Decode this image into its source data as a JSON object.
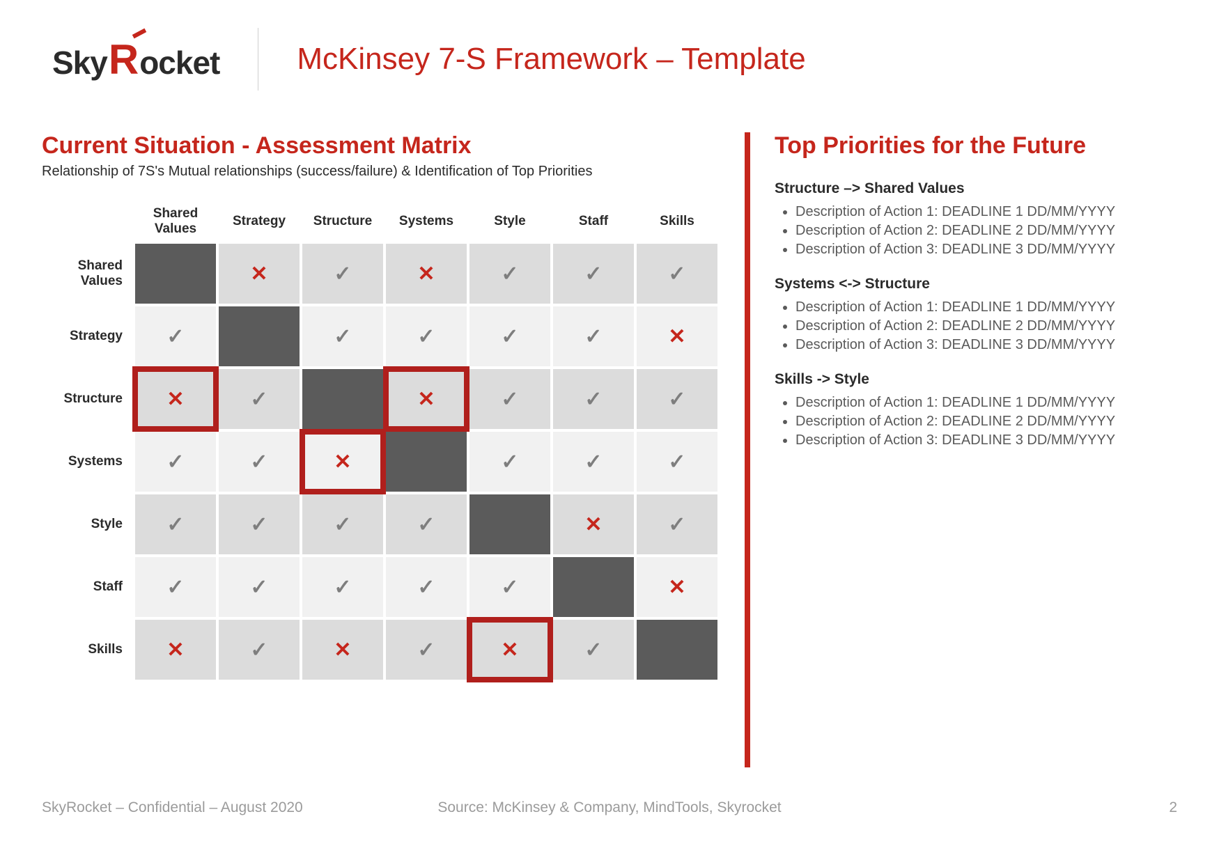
{
  "brand": {
    "part1": "Sky",
    "part2": "R",
    "part3": "ocket"
  },
  "header": {
    "title": "McKinsey 7-S Framework – Template"
  },
  "left_panel": {
    "title": "Current Situation - Assessment Matrix",
    "subtitle": "Relationship of 7S's Mutual relationships (success/failure) & Identification of Top Priorities"
  },
  "matrix": {
    "cols": [
      "Shared Values",
      "Strategy",
      "Structure",
      "Systems",
      "Style",
      "Staff",
      "Skills"
    ],
    "rows": [
      "Shared Values",
      "Strategy",
      "Structure",
      "Systems",
      "Style",
      "Staff",
      "Skills"
    ],
    "cells": [
      [
        "diag",
        "x",
        "v",
        "x",
        "v",
        "v",
        "v"
      ],
      [
        "v",
        "diag",
        "v",
        "v",
        "v",
        "v",
        "x"
      ],
      [
        "x",
        "v",
        "diag",
        "x",
        "v",
        "v",
        "v"
      ],
      [
        "v",
        "v",
        "x",
        "diag",
        "v",
        "v",
        "v"
      ],
      [
        "v",
        "v",
        "v",
        "v",
        "diag",
        "x",
        "v"
      ],
      [
        "v",
        "v",
        "v",
        "v",
        "v",
        "diag",
        "x"
      ],
      [
        "x",
        "v",
        "x",
        "v",
        "x",
        "v",
        "diag"
      ]
    ],
    "highlight": [
      [
        2,
        0
      ],
      [
        2,
        3
      ],
      [
        3,
        2
      ],
      [
        6,
        4
      ]
    ]
  },
  "right_panel": {
    "title": "Top Priorities for the Future",
    "groups": [
      {
        "heading": "Structure –> Shared Values",
        "items": [
          "Description of Action 1: DEADLINE 1 DD/MM/YYYY",
          "Description of Action 2: DEADLINE 2 DD/MM/YYYY",
          "Description of Action 3: DEADLINE 3 DD/MM/YYYY"
        ]
      },
      {
        "heading": "Systems <-> Structure",
        "items": [
          "Description of Action 1: DEADLINE 1 DD/MM/YYYY",
          "Description of Action 2: DEADLINE 2 DD/MM/YYYY",
          "Description of Action 3: DEADLINE 3 DD/MM/YYYY"
        ]
      },
      {
        "heading": "Skills -> Style",
        "items": [
          "Description of Action 1: DEADLINE 1 DD/MM/YYYY",
          "Description of Action 2: DEADLINE 2 DD/MM/YYYY",
          "Description of Action 3: DEADLINE 3 DD/MM/YYYY"
        ]
      }
    ]
  },
  "footer": {
    "left": "SkyRocket – Confidential – August 2020",
    "center": "Source: McKinsey & Company, MindTools, Skyrocket",
    "page": "2"
  },
  "chart_data": {
    "type": "table",
    "title": "7S Assessment Matrix",
    "categories": [
      "Shared Values",
      "Strategy",
      "Structure",
      "Systems",
      "Style",
      "Staff",
      "Skills"
    ],
    "legend": {
      "v": "success",
      "x": "failure",
      "diag": "self"
    },
    "matrix": [
      [
        null,
        "x",
        "v",
        "x",
        "v",
        "v",
        "v"
      ],
      [
        "v",
        null,
        "v",
        "v",
        "v",
        "v",
        "x"
      ],
      [
        "x",
        "v",
        null,
        "x",
        "v",
        "v",
        "v"
      ],
      [
        "v",
        "v",
        "x",
        null,
        "v",
        "v",
        "v"
      ],
      [
        "v",
        "v",
        "v",
        "v",
        null,
        "x",
        "v"
      ],
      [
        "v",
        "v",
        "v",
        "v",
        "v",
        null,
        "x"
      ],
      [
        "x",
        "v",
        "x",
        "v",
        "x",
        "v",
        null
      ]
    ],
    "highlighted_cells": [
      {
        "row": "Structure",
        "col": "Shared Values"
      },
      {
        "row": "Structure",
        "col": "Systems"
      },
      {
        "row": "Systems",
        "col": "Structure"
      },
      {
        "row": "Skills",
        "col": "Style"
      }
    ]
  }
}
